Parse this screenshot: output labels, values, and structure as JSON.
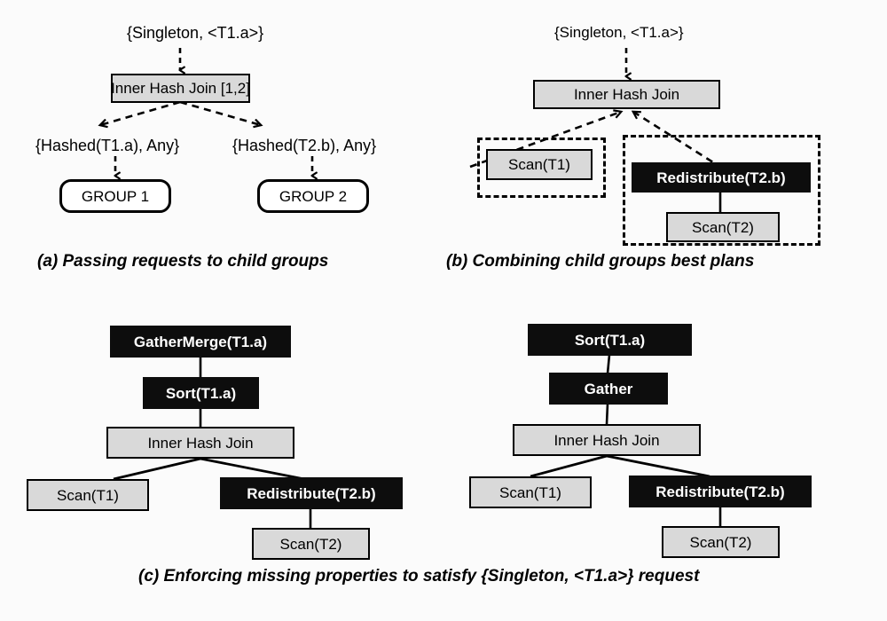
{
  "figure": {
    "background_color": "#fbfbfb",
    "node_gray_color": "#d9d9d9",
    "node_black_color": "#0d0d0d",
    "node_white_color": "#ffffff",
    "stroke_color": "#000000"
  },
  "panel_a": {
    "caption": "(a) Passing requests to child groups",
    "root_request_label": "{Singleton, <T1.a>}",
    "operator": "Inner Hash Join [1,2]",
    "left_request_label": "{Hashed(T1.a), Any}",
    "right_request_label": "{Hashed(T2.b), Any}",
    "left_group": "GROUP 1",
    "right_group": "GROUP 2"
  },
  "panel_b": {
    "caption": "(b) Combining child groups best plans",
    "root_request_label": "{Singleton, <T1.a>}",
    "operator": "Inner Hash Join",
    "left_group_plan": "Scan(T1)",
    "right_group_top": "Redistribute(T2.b)",
    "right_group_bottom": "Scan(T2)"
  },
  "panel_c": {
    "caption": "(c) Enforcing missing properties to satisfy {Singleton, <T1.a>} request",
    "left_tree": {
      "nodes": [
        {
          "label": "GatherMerge(T1.a)",
          "style": "black"
        },
        {
          "label": "Sort(T1.a)",
          "style": "black"
        },
        {
          "label": "Inner Hash Join",
          "style": "gray"
        },
        {
          "label": "Scan(T1)",
          "style": "gray"
        },
        {
          "label": "Redistribute(T2.b)",
          "style": "black"
        },
        {
          "label": "Scan(T2)",
          "style": "gray"
        }
      ]
    },
    "right_tree": {
      "nodes": [
        {
          "label": "Sort(T1.a)",
          "style": "black"
        },
        {
          "label": "Gather",
          "style": "black"
        },
        {
          "label": "Inner Hash Join",
          "style": "gray"
        },
        {
          "label": "Scan(T1)",
          "style": "gray"
        },
        {
          "label": "Redistribute(T2.b)",
          "style": "black"
        },
        {
          "label": "Scan(T2)",
          "style": "gray"
        }
      ]
    }
  }
}
